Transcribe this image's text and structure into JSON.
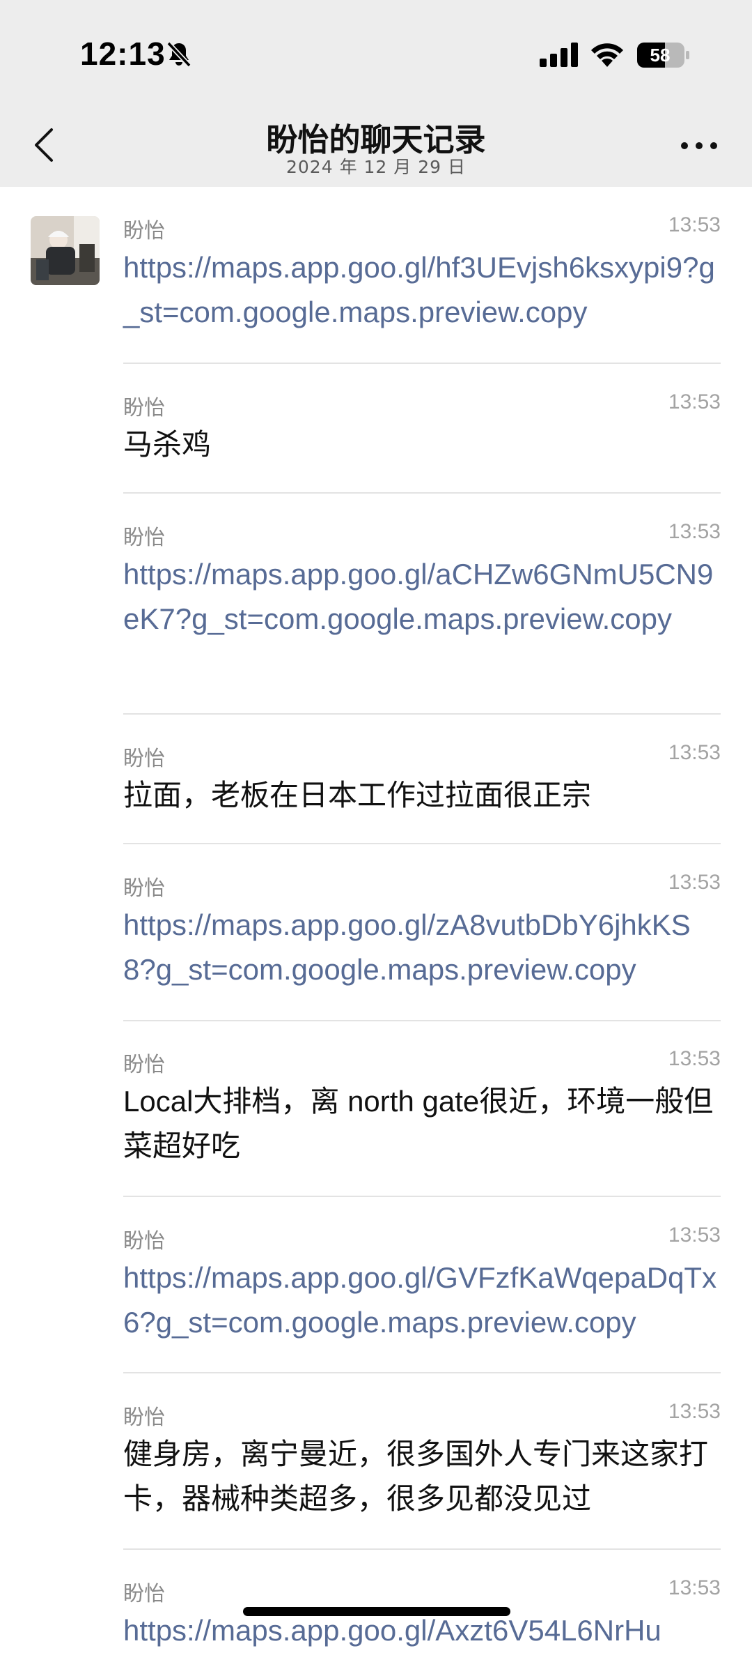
{
  "status_bar": {
    "time": "12:13",
    "battery": "58"
  },
  "nav": {
    "title": "盼怡的聊天记录",
    "subtitle": "2024 年 12 月 29 日"
  },
  "messages": [
    {
      "sender": "盼怡",
      "time": "13:53",
      "text": "https://maps.app.goo.gl/hf3UEvjsh6ksxypi9?g_st=com.google.maps.preview.copy",
      "is_link": true
    },
    {
      "sender": "盼怡",
      "time": "13:53",
      "text": "马杀鸡",
      "is_link": false
    },
    {
      "sender": "盼怡",
      "time": "13:53",
      "text": "https://maps.app.goo.gl/aCHZw6GNmU5CN9eK7?g_st=com.google.maps.preview.copy",
      "is_link": true
    },
    {
      "sender": "盼怡",
      "time": "13:53",
      "text": "拉面，老板在日本工作过拉面很正宗",
      "is_link": false
    },
    {
      "sender": "盼怡",
      "time": "13:53",
      "text": "https://maps.app.goo.gl/zA8vutbDbY6jhkKS8?g_st=com.google.maps.preview.copy",
      "is_link": true
    },
    {
      "sender": "盼怡",
      "time": "13:53",
      "text": "Local大排档，离 north gate很近，环境一般但菜超好吃",
      "is_link": false
    },
    {
      "sender": "盼怡",
      "time": "13:53",
      "text": "https://maps.app.goo.gl/GVFzfKaWqepaDqTx6?g_st=com.google.maps.preview.copy",
      "is_link": true
    },
    {
      "sender": "盼怡",
      "time": "13:53",
      "text": "健身房，离宁曼近，很多国外人专门来这家打卡，器械种类超多，很多见都没见过",
      "is_link": false
    },
    {
      "sender": "盼怡",
      "time": "13:53",
      "text": "https://maps.app.goo.gl/Axzt6V54L6NrHu",
      "is_link": true
    }
  ],
  "colors": {
    "header_bg": "#ededed",
    "link": "#576b95",
    "divider": "#e3e3e3"
  },
  "icons": [
    "back-chevron-icon",
    "more-dots-icon",
    "bell-off-icon",
    "signal-icon",
    "wifi-icon",
    "battery-icon"
  ]
}
